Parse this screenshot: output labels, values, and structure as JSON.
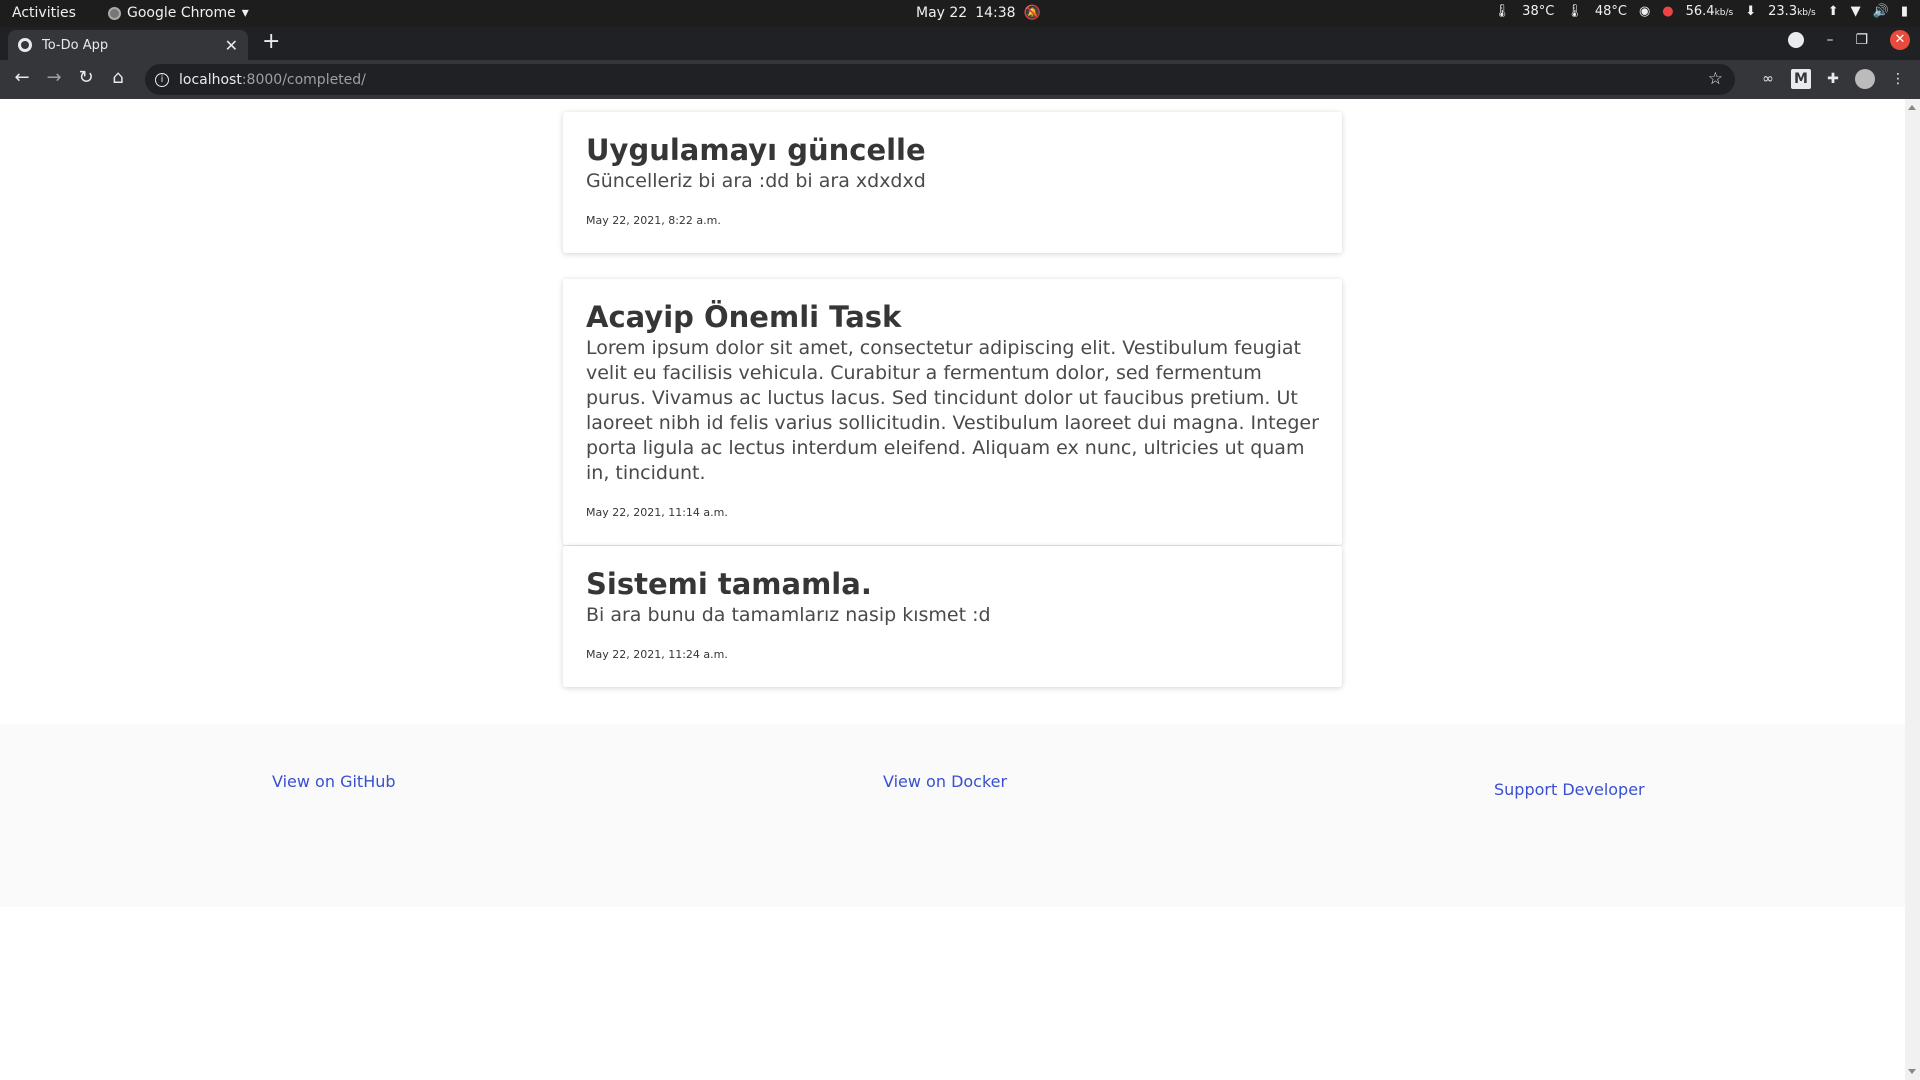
{
  "topbar": {
    "activities": "Activities",
    "app_name": "Google Chrome",
    "date": "May 22",
    "time": "14:38",
    "temp1": "38°C",
    "temp2": "48°C",
    "net_down": "56.4",
    "net_up": "23.3",
    "net_unit": "kb/s"
  },
  "browser": {
    "tab_title": "To-Do App",
    "url_host": "localhost",
    "url_rest": ":8000/completed/"
  },
  "tasks": [
    {
      "title": "Uygulamayı güncelle",
      "description": "Güncelleriz bi ara :dd bi ara xdxdxd",
      "date": "May 22, 2021, 8:22 a.m."
    },
    {
      "title": "Acayip Önemli Task",
      "description": "Lorem ipsum dolor sit amet, consectetur adipiscing elit. Vestibulum feugiat velit eu facilisis vehicula. Curabitur a fermentum dolor, sed fermentum purus. Vivamus ac luctus lacus. Sed tincidunt dolor ut faucibus pretium. Ut laoreet nibh id felis varius sollicitudin. Vestibulum laoreet dui magna. Integer porta ligula ac lectus interdum eleifend. Aliquam ex nunc, ultricies ut quam in, tincidunt.",
      "date": "May 22, 2021, 11:14 a.m."
    },
    {
      "title": "Sistemi tamamla.",
      "description": "Bi ara bunu da tamamlarız nasip kısmet :d",
      "date": "May 22, 2021, 11:24 a.m."
    }
  ],
  "footer": {
    "github": "View on GitHub",
    "docker": "View on Docker",
    "support": "Support Developer"
  },
  "colors": {
    "link": "#3850d0",
    "footer_bg": "#fafafa",
    "chrome_dark": "#35363a"
  }
}
